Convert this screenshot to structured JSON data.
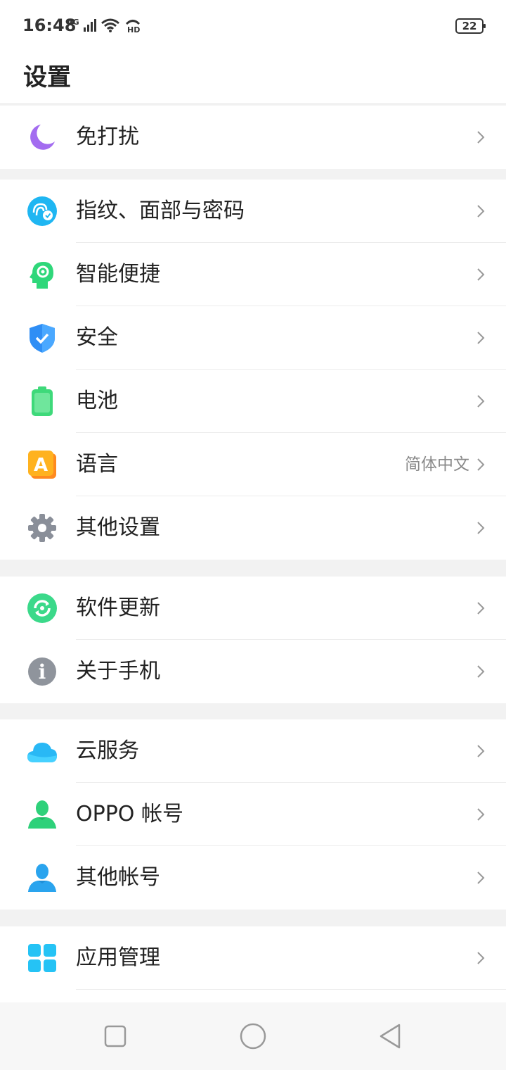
{
  "status_bar": {
    "time": "16:48",
    "network": "4G",
    "battery": "22"
  },
  "header": {
    "title": "设置"
  },
  "groups": [
    {
      "items": [
        {
          "label": "免打扰",
          "icon": "moon-icon"
        }
      ]
    },
    {
      "items": [
        {
          "label": "指纹、面部与密码",
          "icon": "fingerprint-face-icon"
        },
        {
          "label": "智能便捷",
          "icon": "smart-head-icon"
        },
        {
          "label": "安全",
          "icon": "shield-icon"
        },
        {
          "label": "电池",
          "icon": "battery-icon"
        },
        {
          "label": "语言",
          "icon": "language-icon",
          "value": "简体中文"
        },
        {
          "label": "其他设置",
          "icon": "gear-icon"
        }
      ]
    },
    {
      "items": [
        {
          "label": "软件更新",
          "icon": "update-icon"
        },
        {
          "label": "关于手机",
          "icon": "info-icon"
        }
      ]
    },
    {
      "items": [
        {
          "label": "云服务",
          "icon": "cloud-icon"
        },
        {
          "label": "OPPO 帐号",
          "icon": "oppo-account-icon"
        },
        {
          "label": "其他帐号",
          "icon": "other-accounts-icon"
        }
      ]
    },
    {
      "items": [
        {
          "label": "应用管理",
          "icon": "app-management-icon"
        }
      ]
    }
  ],
  "language_icon_letter": "A",
  "info_icon_letter": "i",
  "colors": {
    "moon": "#a36cf0",
    "fingerprint": "#1fb6f2",
    "smart": "#2fd77a",
    "shield": "#2f8ef5",
    "battery": "#3ed97a",
    "language": "#ffb21f",
    "gear": "#8a8f99",
    "update": "#3bd98a",
    "info": "#8f949c",
    "cloud": "#29b8f5",
    "oppo_account": "#2ed17a",
    "other_account": "#2aa4ee",
    "apps": "#25c3f5"
  }
}
